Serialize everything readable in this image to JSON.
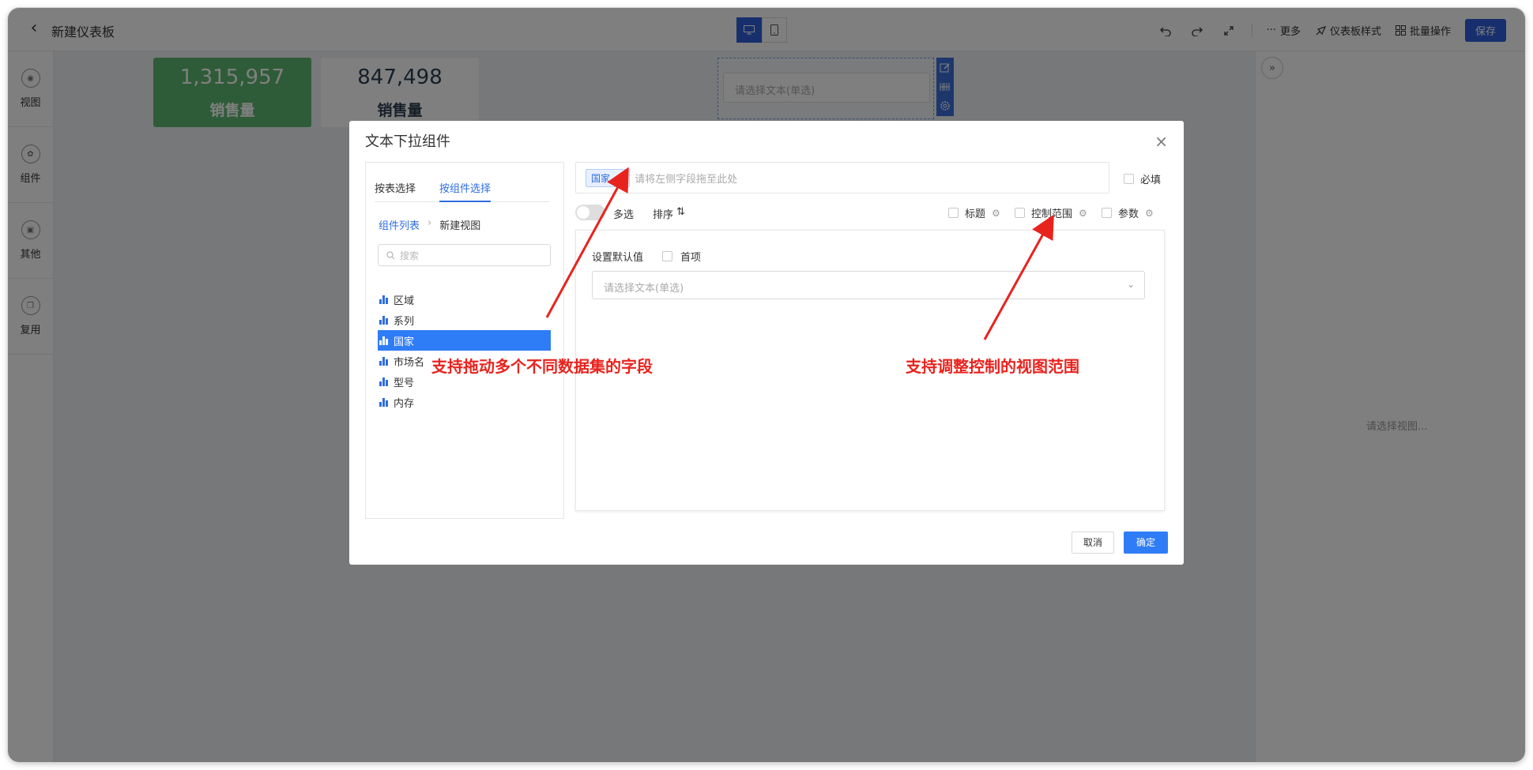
{
  "header": {
    "title": "新建仪表板",
    "tools": {
      "more": "更多",
      "style": "仪表板样式",
      "batch": "批量操作",
      "save": "保存"
    }
  },
  "leftnav": {
    "items": [
      "视图",
      "组件",
      "其他",
      "复用"
    ]
  },
  "kpis": [
    {
      "value": "1,315,957",
      "label": "销售量",
      "bg": "#5cb870",
      "fg": "#ffffff"
    },
    {
      "value": "847,498",
      "label": "销售量",
      "bg": "#ffffff",
      "fg": "#2c3e50"
    }
  ],
  "filter_widget": {
    "placeholder": "请选择文本(单选)"
  },
  "right_panel": {
    "hint": "请选择视图..."
  },
  "dialog": {
    "title": "文本下拉组件",
    "tabs": [
      "按表选择",
      "按组件选择"
    ],
    "breadcrumb": {
      "root": "组件列表",
      "current": "新建视图"
    },
    "search_placeholder": "搜索",
    "fields": [
      "区域",
      "系列",
      "国家",
      "市场名",
      "型号",
      "内存"
    ],
    "selected_field": "国家",
    "drop_zone": {
      "tag": "国家",
      "placeholder": "请将左侧字段拖至此处"
    },
    "required_label": "必填",
    "options": {
      "multi": "多选",
      "sort": "排序",
      "title": "标题",
      "control_range": "控制范围",
      "params": "参数"
    },
    "default_value": {
      "label": "设置默认值",
      "first_item": "首项",
      "placeholder": "请选择文本(单选)"
    },
    "buttons": {
      "cancel": "取消",
      "ok": "确定"
    }
  },
  "annotations": {
    "drag_fields": "支持拖动多个不同数据集的字段",
    "control_range": "支持调整控制的视图范围"
  },
  "colors": {
    "primary": "#2f6de1",
    "annotation": "#e8231e",
    "kpi_green": "#5cb870"
  }
}
